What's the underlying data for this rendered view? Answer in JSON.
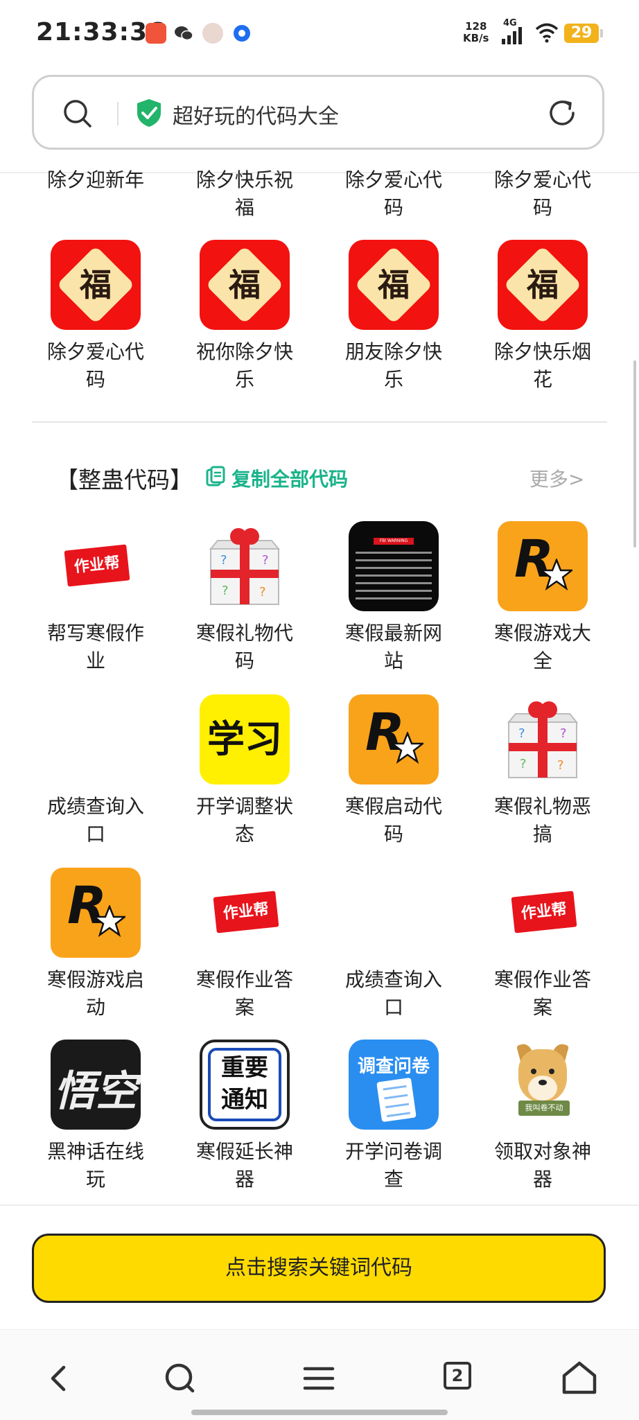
{
  "status_bar": {
    "time": "21:33:36",
    "net_speed_value": "128",
    "net_speed_unit": "KB/s",
    "network": "4G",
    "battery": "29"
  },
  "search": {
    "title": "超好玩的代码大全",
    "icons": [
      "search-icon",
      "shield-check-icon",
      "refresh-icon"
    ]
  },
  "top_partial_row": [
    "除夕迎新年",
    "除夕快乐祝\n福",
    "除夕爱心代\n码",
    "除夕爱心代\n码"
  ],
  "festival_row": [
    {
      "label1": "除夕爱心代",
      "label2": "码",
      "icon": "fu-icon",
      "icon_char": "福"
    },
    {
      "label1": "祝你除夕快",
      "label2": "乐",
      "icon": "fu-icon",
      "icon_char": "福"
    },
    {
      "label1": "朋友除夕快",
      "label2": "乐",
      "icon": "fu-icon",
      "icon_char": "福"
    },
    {
      "label1": "除夕快乐烟",
      "label2": "花",
      "icon": "fu-icon",
      "icon_char": "福"
    }
  ],
  "section": {
    "title": "【整蛊代码】",
    "copy_all": "复制全部代码",
    "more": "更多>",
    "accent_color": "#19b38a"
  },
  "prank_items": [
    {
      "label1": "帮写寒假作",
      "label2": "业",
      "icon": "zuoyebang-icon",
      "icon_text": "作业帮"
    },
    {
      "label1": "寒假礼物代",
      "label2": "码",
      "icon": "gift-box-icon"
    },
    {
      "label1": "寒假最新网",
      "label2": "站",
      "icon": "fbi-warning-icon",
      "icon_text": "FBI WARNING"
    },
    {
      "label1": "寒假游戏大",
      "label2": "全",
      "icon": "rockstar-icon",
      "icon_text": "R"
    },
    {
      "label1": "成绩查询入",
      "label2": "口",
      "icon": "blank-icon"
    },
    {
      "label1": "开学调整状",
      "label2": "态",
      "icon": "xuexi-icon",
      "icon_text": "学习"
    },
    {
      "label1": "寒假启动代",
      "label2": "码",
      "icon": "rockstar-icon",
      "icon_text": "R"
    },
    {
      "label1": "寒假礼物恶",
      "label2": "搞",
      "icon": "gift-box-icon"
    },
    {
      "label1": "寒假游戏启",
      "label2": "动",
      "icon": "rockstar-icon",
      "icon_text": "R"
    },
    {
      "label1": "寒假作业答",
      "label2": "案",
      "icon": "zuoyebang-icon",
      "icon_text": "作业帮"
    },
    {
      "label1": "成绩查询入",
      "label2": "口",
      "icon": "blank-icon"
    },
    {
      "label1": "寒假作业答",
      "label2": "案",
      "icon": "zuoyebang-icon",
      "icon_text": "作业帮"
    },
    {
      "label1": "黑神话在线",
      "label2": "玩",
      "icon": "wukong-icon",
      "icon_text": "悟空"
    },
    {
      "label1": "寒假延长神",
      "label2": "器",
      "icon": "notice-icon",
      "icon_text1": "重要",
      "icon_text2": "通知"
    },
    {
      "label1": "开学问卷调",
      "label2": "查",
      "icon": "survey-icon",
      "icon_text": "调查问卷"
    },
    {
      "label1": "领取对象神",
      "label2": "器",
      "icon": "doge-icon",
      "icon_text": "我叫卷不动"
    }
  ],
  "cta": {
    "label": "点击搜索关键词代码",
    "color": "#ffda00"
  },
  "bottom_nav": {
    "items": [
      "back-icon",
      "search-icon",
      "menu-icon",
      "tabs-icon",
      "home-icon"
    ],
    "tab_count": "2"
  }
}
